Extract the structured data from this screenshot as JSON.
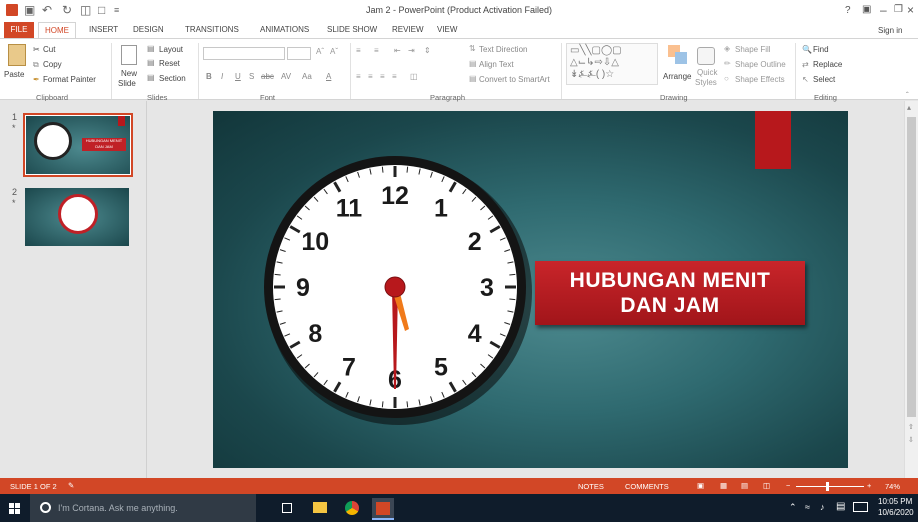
{
  "window": {
    "title": "Jam 2 - PowerPoint (Product Activation Failed)",
    "help": "?",
    "sign_in": "Sign in"
  },
  "tabs": [
    "FILE",
    "HOME",
    "INSERT",
    "DESIGN",
    "TRANSITIONS",
    "ANIMATIONS",
    "SLIDE SHOW",
    "REVIEW",
    "VIEW"
  ],
  "ribbon": {
    "clipboard": {
      "paste": "Paste",
      "cut": "Cut",
      "copy": "Copy",
      "format_painter": "Format Painter",
      "label": "Clipboard"
    },
    "slides": {
      "new_slide_1": "New",
      "new_slide_2": "Slide",
      "layout": "Layout",
      "reset": "Reset",
      "section": "Section",
      "label": "Slides"
    },
    "font": {
      "label": "Font",
      "bold": "B",
      "italic": "I",
      "underline": "U",
      "shadow": "S",
      "strike": "abc",
      "spacing": "AV",
      "case": "Aa",
      "color": "A"
    },
    "paragraph": {
      "text_direction": "Text Direction",
      "align_text": "Align Text",
      "convert_smartart": "Convert to SmartArt",
      "label": "Paragraph"
    },
    "drawing": {
      "arrange": "Arrange",
      "quick_styles_1": "Quick",
      "quick_styles_2": "Styles",
      "shape_fill": "Shape Fill",
      "shape_outline": "Shape Outline",
      "shape_effects": "Shape Effects",
      "label": "Drawing"
    },
    "editing": {
      "find": "Find",
      "replace": "Replace",
      "select": "Select",
      "label": "Editing"
    }
  },
  "thumbnails": [
    {
      "num": "1",
      "star": "*",
      "title": "HUBUNGAN MENIT DAN JAM",
      "selected": true
    },
    {
      "num": "2",
      "star": "*",
      "selected": false
    }
  ],
  "slide": {
    "title_line1": "HUBUNGAN MENIT",
    "title_line2": "DAN JAM",
    "clock_numbers": [
      "12",
      "1",
      "2",
      "3",
      "4",
      "5",
      "6",
      "7",
      "8",
      "9",
      "10",
      "11"
    ],
    "accent_red": "#b7181c",
    "bg_teal": "#2f6a70"
  },
  "status": {
    "slide_of": "SLIDE 1 OF 2",
    "notes": "NOTES",
    "comments": "COMMENTS",
    "zoom": "74%"
  },
  "taskbar": {
    "cortana": "I'm Cortana. Ask me anything.",
    "time": "10:05 PM",
    "date": "10/6/2020"
  }
}
